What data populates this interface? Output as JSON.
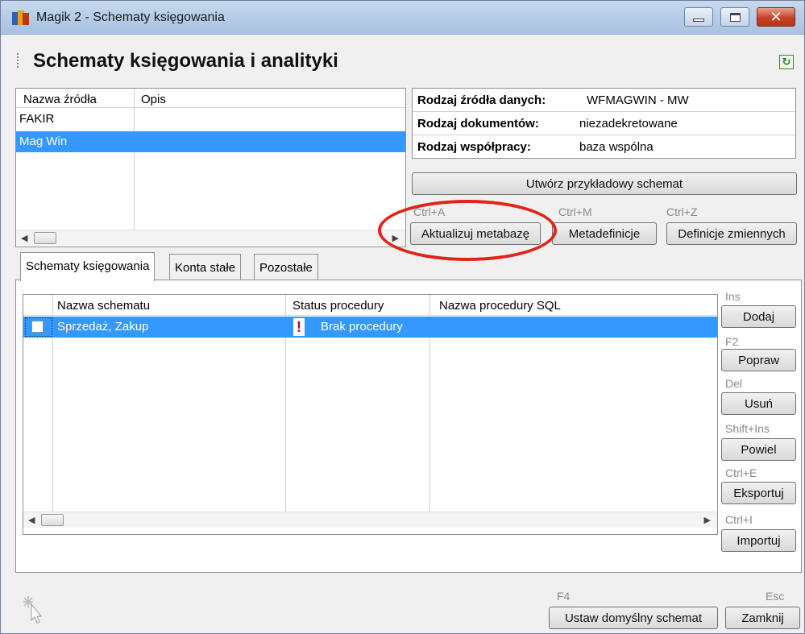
{
  "window": {
    "title": "Magik 2 - Schematy księgowania",
    "minimize": "_",
    "maximize": "□",
    "close": "✕"
  },
  "header": {
    "title": "Schematy księgowania i analityki"
  },
  "sources": {
    "columns": [
      "Nazwa źródła",
      "Opis"
    ],
    "rows": [
      {
        "name": "FAKIR",
        "desc": ""
      },
      {
        "name": "Mag Win",
        "desc": "",
        "selected": true
      }
    ]
  },
  "info": {
    "rows": [
      {
        "label": "Rodzaj źródła danych:",
        "value": "WFMAGWIN - MW"
      },
      {
        "label": "Rodzaj dokumentów:",
        "value": "niezadekretowane"
      },
      {
        "label": "Rodzaj współpracy:",
        "value": "baza wspólna"
      }
    ]
  },
  "actions": {
    "create_example": "Utwórz przykładowy schemat",
    "update_metabase": {
      "label": "Aktualizuj metabazę",
      "shortcut": "Ctrl+A"
    },
    "metadefinitions": {
      "label": "Metadefinicje",
      "shortcut": "Ctrl+M"
    },
    "variable_defs": {
      "label": "Definicje zmiennych",
      "shortcut": "Ctrl+Z"
    }
  },
  "tabs": [
    "Schematy księgowania",
    "Konta stałe",
    "Pozostałe"
  ],
  "schemas": {
    "columns": [
      "Nazwa schematu",
      "Status procedury",
      "Nazwa procedury SQL"
    ],
    "rows": [
      {
        "name": "Sprzedaż, Zakup",
        "status": "Brak procedury",
        "sql": "",
        "checked": false
      }
    ]
  },
  "side_buttons": [
    {
      "shortcut": "Ins",
      "label": "Dodaj"
    },
    {
      "shortcut": "F2",
      "label": "Popraw"
    },
    {
      "shortcut": "Del",
      "label": "Usuń"
    },
    {
      "shortcut": "Shift+Ins",
      "label": "Powiel"
    },
    {
      "shortcut": "Ctrl+E",
      "label": "Eksportuj"
    },
    {
      "shortcut": "Ctrl+I",
      "label": "Importuj"
    }
  ],
  "footer": {
    "default_schema": {
      "label": "Ustaw domyślny schemat",
      "shortcut": "F4"
    },
    "close": {
      "label": "Zamknij",
      "shortcut": "Esc"
    }
  },
  "icons": {
    "app": "magik-app-icon",
    "refresh": "refresh-icon",
    "warning": "exclamation-icon",
    "cursor": "wait-cursor-icon"
  },
  "colors": {
    "selection": "#3399ff",
    "highlight_ellipse": "#e2231a",
    "titlebar": "#b4cbe6"
  }
}
